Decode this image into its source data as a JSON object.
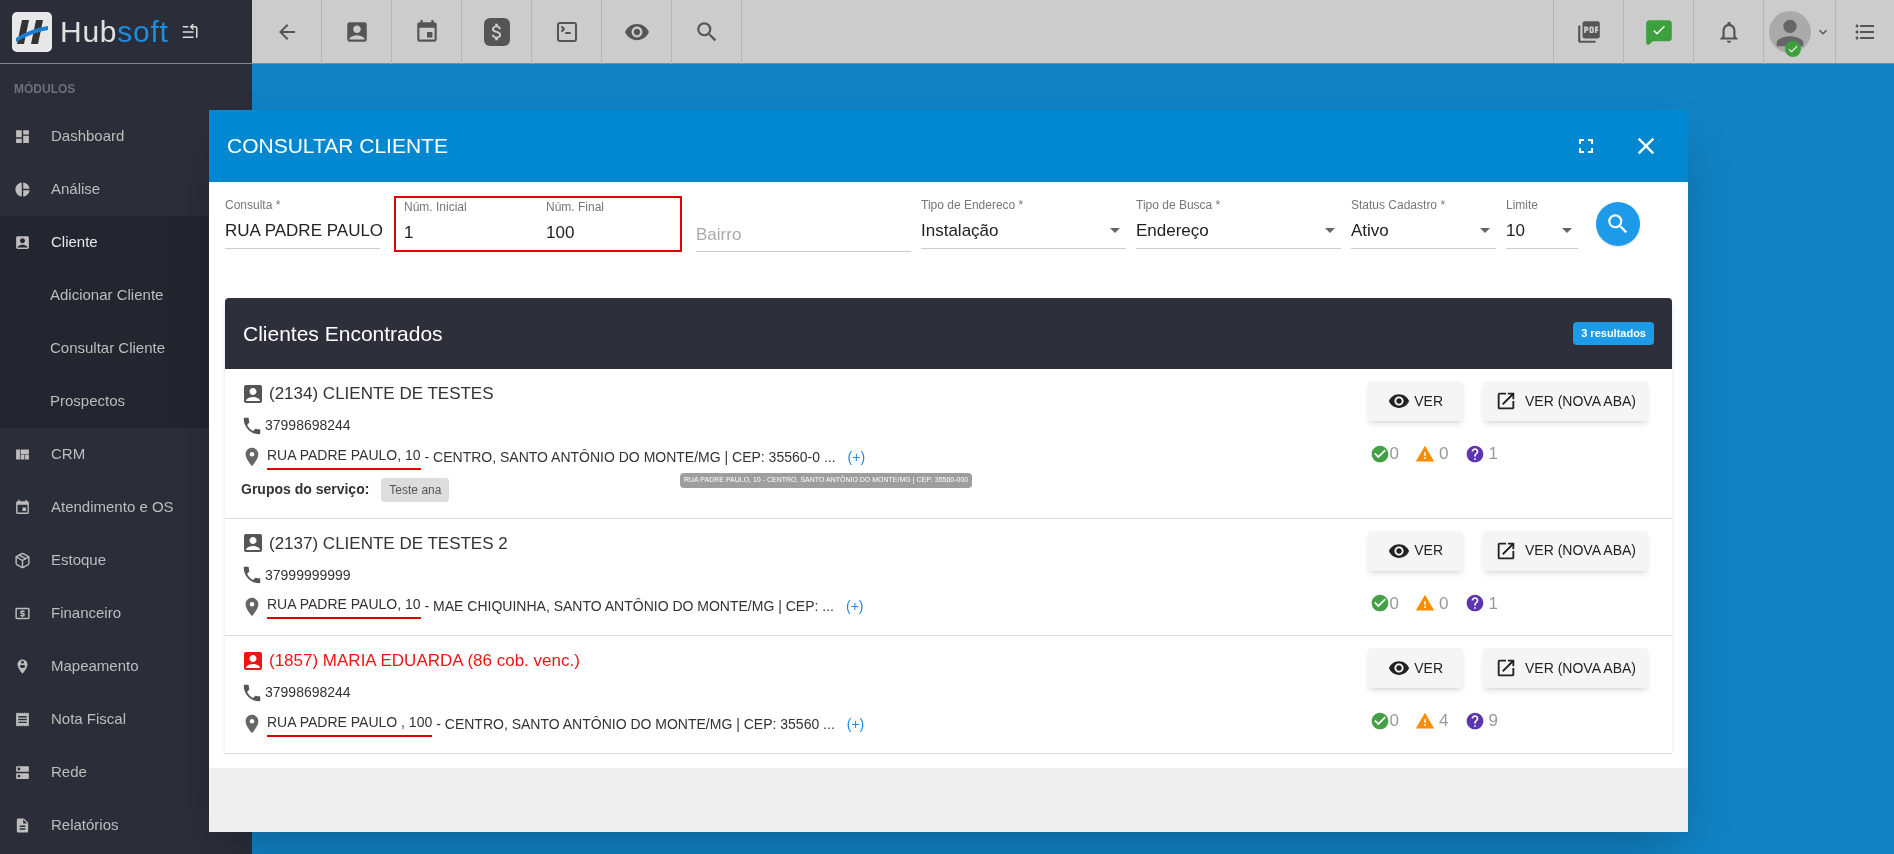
{
  "brand": {
    "first": "Hub",
    "second": "soft"
  },
  "sidebar": {
    "heading": "MÓDULOS",
    "items": [
      {
        "label": "Dashboard",
        "expanded": false
      },
      {
        "label": "Análise",
        "expanded": false
      },
      {
        "label": "Cliente",
        "expanded": true,
        "children": [
          {
            "label": "Adicionar Cliente"
          },
          {
            "label": "Consultar Cliente"
          },
          {
            "label": "Prospectos"
          }
        ]
      },
      {
        "label": "CRM",
        "expanded": false
      },
      {
        "label": "Atendimento e OS",
        "expanded": false
      },
      {
        "label": "Estoque",
        "expanded": false
      },
      {
        "label": "Financeiro",
        "expanded": false
      },
      {
        "label": "Mapeamento",
        "expanded": false
      },
      {
        "label": "Nota Fiscal",
        "expanded": false
      },
      {
        "label": "Rede",
        "expanded": false
      },
      {
        "label": "Relatórios",
        "expanded": false
      }
    ]
  },
  "modal": {
    "title": "CONSULTAR CLIENTE"
  },
  "form": {
    "fields": [
      {
        "kind": "text",
        "label": "Consulta *",
        "value": "RUA PADRE PAULO"
      },
      {
        "kind": "range",
        "highlighted": true,
        "fields": [
          {
            "label": "Núm. Inicial",
            "value": "1"
          },
          {
            "label": "Núm. Final",
            "value": "100"
          }
        ]
      },
      {
        "kind": "placeholder",
        "placeholder": "Bairro"
      },
      {
        "kind": "select",
        "label": "Tipo de Endereco *",
        "value": "Instalação"
      },
      {
        "kind": "select",
        "label": "Tipo de Busca *",
        "value": "Endereço"
      },
      {
        "kind": "select",
        "label": "Status Cadastro *",
        "value": "Ativo"
      },
      {
        "kind": "select",
        "label": "Limite",
        "value": "10"
      }
    ]
  },
  "results": {
    "title": "Clientes Encontrados",
    "count": "3 resultados",
    "rows": [
      {
        "name": "(2134) CLIENTE DE TESTES",
        "overdue": false,
        "phone": "37998698244",
        "street": "RUA PADRE PAULO, 10",
        "underlined": true,
        "rest": "- CENTRO, SANTO ANTÔNIO DO MONTE/MG | CEP: 35560-0 ...",
        "more": "(+)",
        "groups_label": "Grupos do serviço:",
        "groups": [
          "Teste ana"
        ],
        "tooltip": "RUA PADRE PAULO, 10 - CENTRO, SANTO ANTÔNIO DO MONTE/MG | CEP: 35560-000",
        "ok": "0",
        "warning": "0",
        "question": "1",
        "view": "VER",
        "view_tab": "VER (NOVA ABA)"
      },
      {
        "name": "(2137) CLIENTE DE TESTES 2",
        "overdue": false,
        "phone": "37999999999",
        "street": "RUA PADRE PAULO, 10",
        "underlined": true,
        "rest": "- MAE CHIQUINHA, SANTO ANTÔNIO DO MONTE/MG | CEP: ...",
        "more": "(+)",
        "ok": "0",
        "warning": "0",
        "question": "1",
        "view": "VER",
        "view_tab": "VER (NOVA ABA)"
      },
      {
        "name": "(1857) MARIA EDUARDA (86 cob. venc.)",
        "overdue": true,
        "phone": "37998698244",
        "street": "RUA PADRE PAULO , 100",
        "underlined": true,
        "rest": "- CENTRO, SANTO ANTÔNIO DO MONTE/MG | CEP: 35560 ...",
        "more": "(+)",
        "ok": "0",
        "warning": "4",
        "question": "9",
        "view": "VER",
        "view_tab": "VER (NOVA ABA)"
      }
    ]
  }
}
